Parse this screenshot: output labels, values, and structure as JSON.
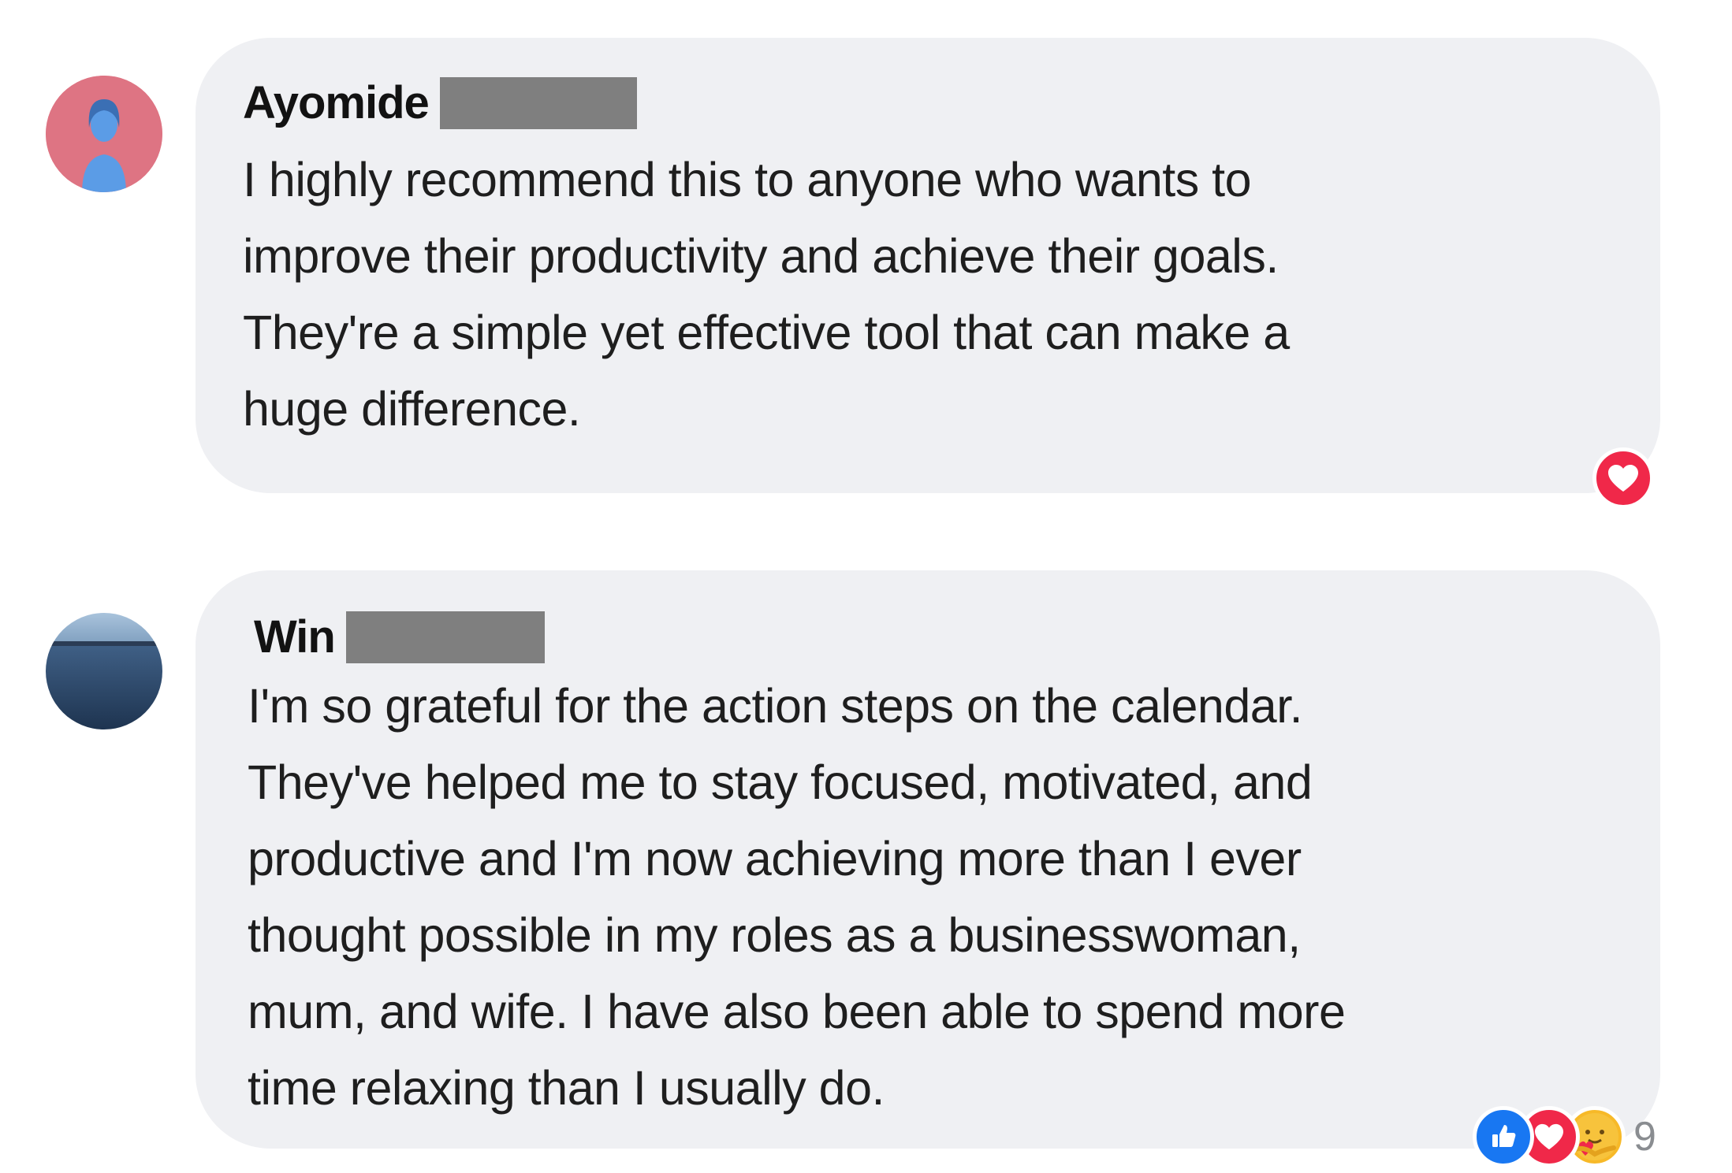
{
  "comments": [
    {
      "author": "Ayomide",
      "text_lines": [
        "I highly recommend this to anyone who wants to",
        "improve their productivity and achieve their goals.",
        "They're a simple yet effective tool that can make a",
        "huge difference."
      ],
      "reactions": [
        "love-icon"
      ],
      "avatar": "person-avatar"
    },
    {
      "author": "Win",
      "text_lines": [
        "I'm so grateful for the action steps on the calendar.",
        "They've helped me to stay focused, motivated, and",
        "productive and I'm now achieving more than I ever",
        "thought possible in my roles as a businesswoman,",
        "mum, and wife. I have also been able to spend more",
        "time relaxing than I usually do."
      ],
      "reactions": [
        "like-icon",
        "love-icon",
        "care-icon"
      ],
      "reaction_count": "9",
      "avatar": "seascape-avatar"
    }
  ],
  "colors": {
    "bubble_bg": "#eff0f3",
    "redaction": "#7f7f7f",
    "like_blue": "#1877f2",
    "love_red": "#f02849",
    "care_yellow": "#f7b928"
  }
}
